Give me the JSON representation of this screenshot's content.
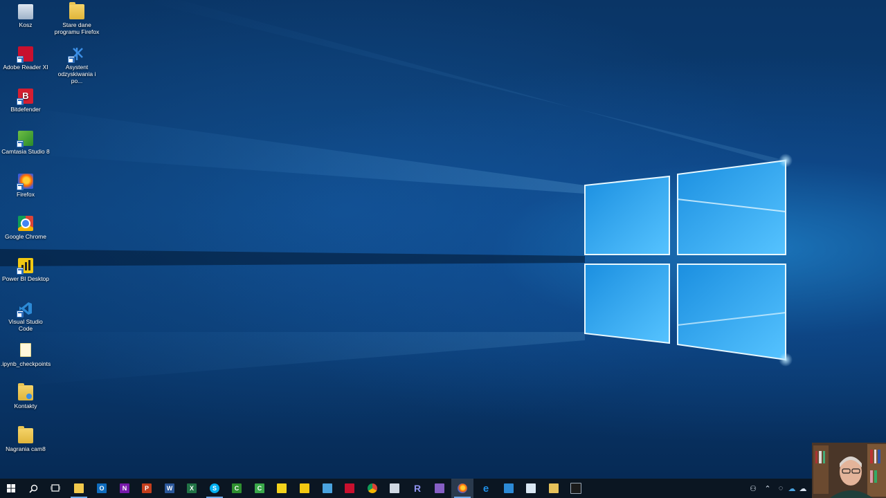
{
  "desktop": {
    "icons": [
      {
        "label": "Kosz",
        "icon": "recycle-bin-icon"
      },
      {
        "label": "Stare dane programu Firefox",
        "icon": "folder-icon"
      },
      {
        "label": "Adobe Reader XI",
        "icon": "adobe-reader-icon"
      },
      {
        "label": "Asystent odzyskiwania i po...",
        "icon": "recovery-assistant-icon"
      },
      {
        "label": "Bitdefender",
        "icon": "bitdefender-icon"
      },
      {
        "label": "Camtasia Studio 8",
        "icon": "camtasia-icon"
      },
      {
        "label": "Firefox",
        "icon": "firefox-icon"
      },
      {
        "label": "Google Chrome",
        "icon": "chrome-icon"
      },
      {
        "label": "Power BI Desktop",
        "icon": "power-bi-icon"
      },
      {
        "label": "Visual Studio Code",
        "icon": "vscode-icon"
      },
      {
        "label": ".ipynb_checkpoints",
        "icon": "file-icon"
      },
      {
        "label": "Kontakty",
        "icon": "contacts-folder-icon"
      },
      {
        "label": "Nagrania cam8",
        "icon": "folder-icon"
      }
    ]
  },
  "taskbar": {
    "items": [
      {
        "icon": "windows-start-icon",
        "glyph": "⊞",
        "color": "#ffffff"
      },
      {
        "icon": "search-icon",
        "glyph": "⌕",
        "color": "#ffffff"
      },
      {
        "icon": "task-view-icon",
        "glyph": "▭",
        "color": "#ffffff"
      },
      {
        "icon": "file-explorer-icon",
        "glyph": "",
        "color": "#f2c94c"
      },
      {
        "icon": "outlook-icon",
        "glyph": "O",
        "color": "#0f6cbd"
      },
      {
        "icon": "onenote-icon",
        "glyph": "N",
        "color": "#7719aa"
      },
      {
        "icon": "powerpoint-icon",
        "glyph": "P",
        "color": "#c43e1c"
      },
      {
        "icon": "word-icon",
        "glyph": "W",
        "color": "#2b579a"
      },
      {
        "icon": "excel-icon",
        "glyph": "X",
        "color": "#217346"
      },
      {
        "icon": "skype-icon",
        "glyph": "S",
        "color": "#00aff0"
      },
      {
        "icon": "camtasia-recorder-icon",
        "glyph": "C",
        "color": "#2f8f2f"
      },
      {
        "icon": "camtasia-studio-icon",
        "glyph": "C",
        "color": "#3aa84a"
      },
      {
        "icon": "sticky-notes-icon",
        "glyph": "",
        "color": "#f3d21b"
      },
      {
        "icon": "power-bi-icon",
        "glyph": "",
        "color": "#f2c811"
      },
      {
        "icon": "remote-desktop-icon",
        "glyph": "",
        "color": "#4aa3df"
      },
      {
        "icon": "acrobat-icon",
        "glyph": "",
        "color": "#c8102e"
      },
      {
        "icon": "chrome-icon",
        "glyph": "",
        "color": "#db4437"
      },
      {
        "icon": "document-icon",
        "glyph": "",
        "color": "#cfd8e3"
      },
      {
        "icon": "r-icon",
        "glyph": "R",
        "color": "#6b6fd6"
      },
      {
        "icon": "visual-studio-icon",
        "glyph": "",
        "color": "#865fc5"
      },
      {
        "icon": "firefox-icon",
        "glyph": "",
        "color": "#ff7139"
      },
      {
        "icon": "edge-icon",
        "glyph": "e",
        "color": "#1f8fe6"
      },
      {
        "icon": "vscode-icon",
        "glyph": "",
        "color": "#2c8ad6"
      },
      {
        "icon": "notepad-icon",
        "glyph": "",
        "color": "#d9e6f2"
      },
      {
        "icon": "snipping-tool-icon",
        "glyph": "",
        "color": "#e6c15a"
      },
      {
        "icon": "command-prompt-icon",
        "glyph": "",
        "color": "#1b1b1b"
      }
    ],
    "tray": [
      {
        "icon": "people-icon"
      },
      {
        "icon": "chevron-up-icon"
      },
      {
        "icon": "network-icon"
      },
      {
        "icon": "onedrive-icon"
      },
      {
        "icon": "cloud-icon"
      }
    ]
  }
}
